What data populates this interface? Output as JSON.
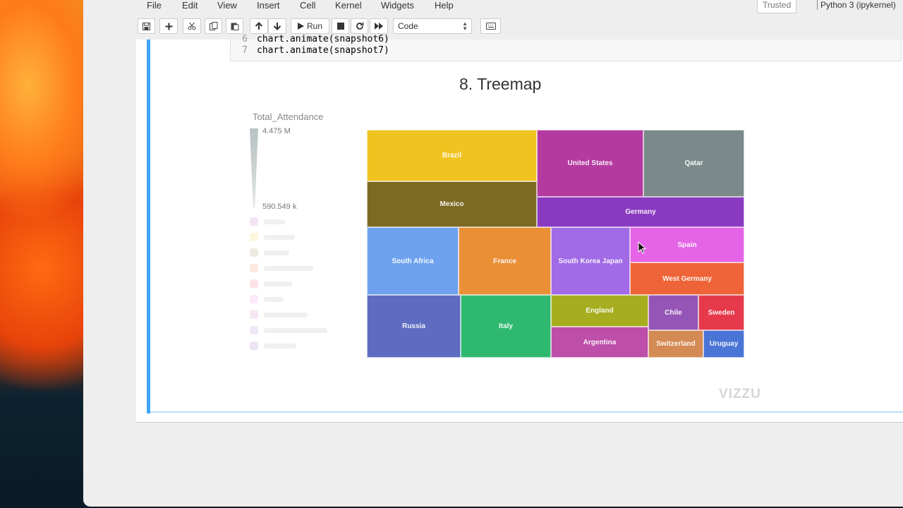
{
  "menu": {
    "items": [
      "File",
      "Edit",
      "View",
      "Insert",
      "Cell",
      "Kernel",
      "Widgets",
      "Help"
    ],
    "trusted": "Trusted",
    "kernel": "Python 3 (ipykernel)"
  },
  "toolbar": {
    "save_icon": "save-icon",
    "run_label": "Run",
    "cell_type": "Code"
  },
  "code": {
    "lines": [
      {
        "num": "6",
        "text": "chart.animate(snapshot6)"
      },
      {
        "num": "7",
        "text": "chart.animate(snapshot7)"
      }
    ]
  },
  "output": {
    "title": "8. Treemap",
    "legend_title": "Total_Attendance",
    "legend_max": "4.475 M",
    "legend_min": "590.549 k",
    "logo": "VIZZU"
  },
  "treemap": {
    "tiles": [
      {
        "label": "Brazil",
        "color": "#f0c420"
      },
      {
        "label": "United States",
        "color": "#b43aa0"
      },
      {
        "label": "Qatar",
        "color": "#7a8a8a"
      },
      {
        "label": "Mexico",
        "color": "#7c6a22"
      },
      {
        "label": "Germany",
        "color": "#8a3ac0"
      },
      {
        "label": "South Africa",
        "color": "#6ea2ee"
      },
      {
        "label": "France",
        "color": "#ea8f35"
      },
      {
        "label": "South Korea Japan",
        "color": "#a16ae6"
      },
      {
        "label": "Spain",
        "color": "#e463e6"
      },
      {
        "label": "West Germany",
        "color": "#ee6438"
      },
      {
        "label": "Russia",
        "color": "#5d6bc1"
      },
      {
        "label": "Italy",
        "color": "#2fb970"
      },
      {
        "label": "England",
        "color": "#a6ad1e"
      },
      {
        "label": "Argentina",
        "color": "#bd4ea9"
      },
      {
        "label": "Chile",
        "color": "#9555b6"
      },
      {
        "label": "Sweden",
        "color": "#e63a4c"
      },
      {
        "label": "Switzerland",
        "color": "#d48a54"
      },
      {
        "label": "Uruguay",
        "color": "#4a74d6"
      }
    ]
  }
}
